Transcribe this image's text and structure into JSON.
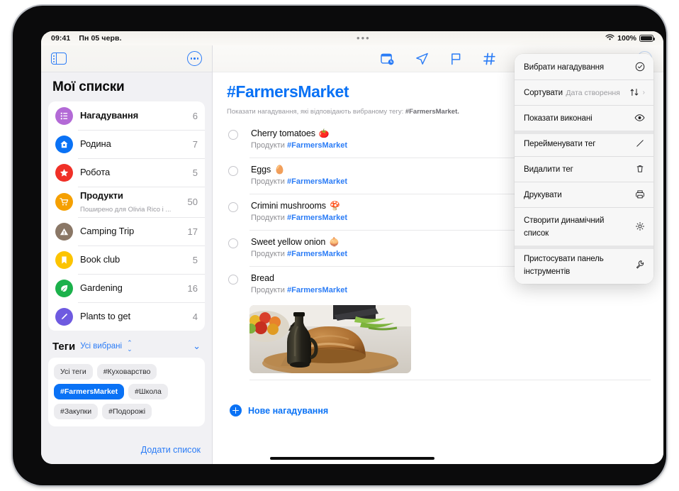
{
  "status_bar": {
    "time": "09:41",
    "date": "Пн 05 черв.",
    "battery_percent": "100%",
    "wifi_icon": "wifi-icon",
    "battery_icon": "battery-full-icon",
    "window_dots_icon": "window-controls-icon"
  },
  "sidebar": {
    "toggle_icon": "sidebar-toggle-icon",
    "more_icon": "more-circle-icon",
    "title": "Мої списки",
    "lists": [
      {
        "name": "Нагадування",
        "count": "6",
        "icon": "list-bullet-icon",
        "color": "#b36ad6",
        "subtitle": ""
      },
      {
        "name": "Родина",
        "count": "7",
        "icon": "house-icon",
        "color": "#0a72f5",
        "subtitle": ""
      },
      {
        "name": "Робота",
        "count": "5",
        "icon": "star-icon",
        "color": "#f03027",
        "subtitle": ""
      },
      {
        "name": "Продукти",
        "count": "50",
        "icon": "cart-icon",
        "color": "#f5a000",
        "subtitle": "Поширено для Olivia Rico і ..."
      },
      {
        "name": "Camping Trip",
        "count": "17",
        "icon": "warning-triangle-icon",
        "color": "#8a7766",
        "subtitle": ""
      },
      {
        "name": "Book club",
        "count": "5",
        "icon": "bookmark-icon",
        "color": "#fcc400",
        "subtitle": ""
      },
      {
        "name": "Gardening",
        "count": "16",
        "icon": "leaf-icon",
        "color": "#1bb14b",
        "subtitle": ""
      },
      {
        "name": "Plants to get",
        "count": "4",
        "icon": "pen-icon",
        "color": "#6e5ae0",
        "subtitle": ""
      }
    ],
    "tags_header": {
      "title": "Теги",
      "selection": "Усі вибрані",
      "selector_icon": "up-down-chevron-icon",
      "collapse_icon": "chevron-down-icon"
    },
    "tags": [
      {
        "label": "Усі теги",
        "active": false
      },
      {
        "label": "#Куховарство",
        "active": false
      },
      {
        "label": "#FarmersMarket",
        "active": true
      },
      {
        "label": "#Школа",
        "active": false
      },
      {
        "label": "#Закупки",
        "active": false
      },
      {
        "label": "#Подорожі",
        "active": false
      }
    ],
    "add_list_label": "Додати список"
  },
  "main": {
    "toolbar_icons": [
      "calendar-clock-icon",
      "navigation-arrow-icon",
      "flag-icon",
      "hashtag-icon"
    ],
    "more_icon": "more-circle-icon",
    "title": "#FarmersMarket",
    "subtitle_prefix": "Показати нагадування, які відповідають вибраному тегу: ",
    "subtitle_tag": "#FarmersMarket.",
    "reminders": [
      {
        "title": "Cherry tomatoes",
        "emoji": "🍅",
        "list": "Продукти",
        "tag": "#FarmersMarket",
        "has_photo": false
      },
      {
        "title": "Eggs",
        "emoji": "🥚",
        "list": "Продукти",
        "tag": "#FarmersMarket",
        "has_photo": false
      },
      {
        "title": "Crimini mushrooms",
        "emoji": "🍄",
        "list": "Продукти",
        "tag": "#FarmersMarket",
        "has_photo": false
      },
      {
        "title": "Sweet yellow onion",
        "emoji": "🧅",
        "list": "Продукти",
        "tag": "#FarmersMarket",
        "has_photo": false
      },
      {
        "title": "Bread",
        "emoji": "",
        "list": "Продукти",
        "tag": "#FarmersMarket",
        "has_photo": true
      }
    ],
    "photo_alt": "bread-photo",
    "new_reminder_label": "Нове нагадування",
    "new_reminder_icon": "plus-circle-icon"
  },
  "context_menu": {
    "items": [
      {
        "label": "Вибрати нагадування",
        "sub": "",
        "icon": "check-circle-icon",
        "chevron": false,
        "group_start": false
      },
      {
        "label": "Сортувати",
        "sub": "Дата створення",
        "icon": "sort-arrows-icon",
        "chevron": true,
        "group_start": false
      },
      {
        "label": "Показати виконані",
        "sub": "",
        "icon": "eye-icon",
        "chevron": false,
        "group_start": false
      },
      {
        "label": "Перейменувати тег",
        "sub": "",
        "icon": "pencil-icon",
        "chevron": false,
        "group_start": true
      },
      {
        "label": "Видалити тег",
        "sub": "",
        "icon": "trash-icon",
        "chevron": false,
        "group_start": false
      },
      {
        "label": "Друкувати",
        "sub": "",
        "icon": "printer-icon",
        "chevron": false,
        "group_start": false
      },
      {
        "label": "Створити динамічний список",
        "sub": "",
        "icon": "gear-icon",
        "chevron": false,
        "group_start": false
      },
      {
        "label": "Пристосувати панель інструментів",
        "sub": "",
        "icon": "wrench-icon",
        "chevron": false,
        "group_start": true
      }
    ]
  },
  "colors": {
    "accent_blue": "#0a72f5",
    "tint_blue": "#2b7cf6",
    "sidebar_bg": "#f1f1f4",
    "card_bg": "#ffffff",
    "muted_text": "#8e8e93"
  }
}
